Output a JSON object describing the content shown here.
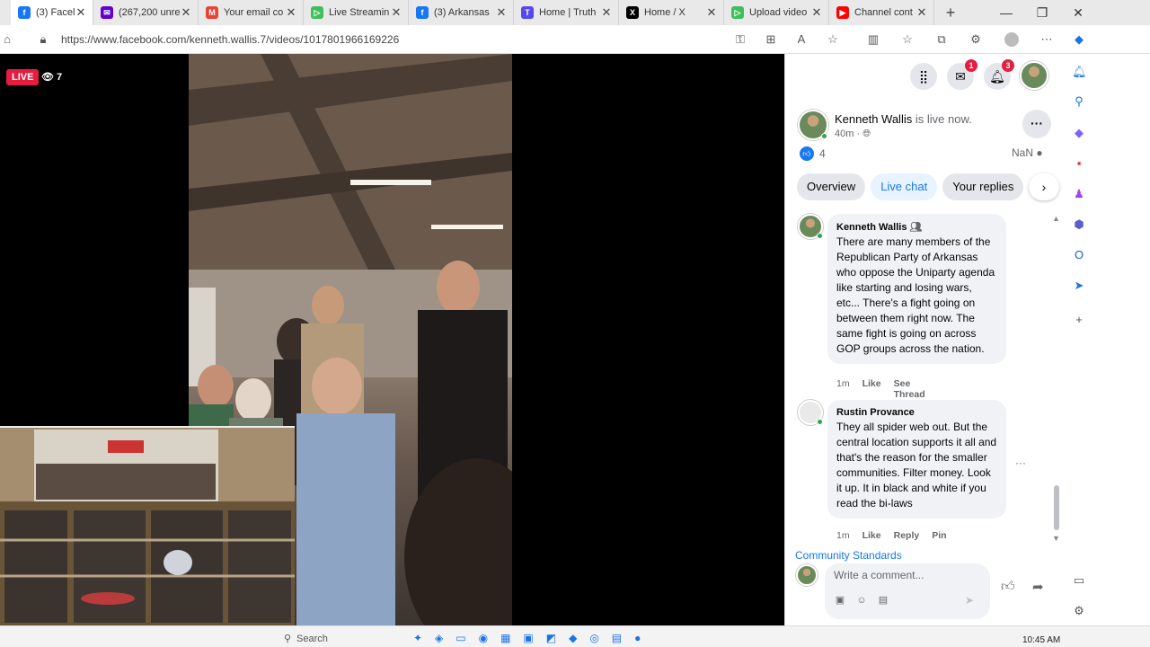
{
  "browser": {
    "tabs": [
      {
        "title": "(3) Facel",
        "color": "#1877f2",
        "glyph": "f"
      },
      {
        "title": "(267,200 unre",
        "color": "#6001d2",
        "glyph": "✉"
      },
      {
        "title": "Your email co",
        "color": "#ea4335",
        "glyph": "M"
      },
      {
        "title": "Live Streamin",
        "color": "#3fbf5a",
        "glyph": "▷"
      },
      {
        "title": "(3) Arkansas",
        "color": "#1877f2",
        "glyph": "f"
      },
      {
        "title": "Home | Truth",
        "color": "#5448ee",
        "glyph": "T"
      },
      {
        "title": "Home / X",
        "color": "#000000",
        "glyph": "X"
      },
      {
        "title": "Upload video",
        "color": "#3fbf5a",
        "glyph": "▷"
      },
      {
        "title": "Channel cont",
        "color": "#ff0000",
        "glyph": "▶"
      }
    ],
    "url": "https://www.facebook.com/kenneth.wallis.7/videos/1017801966169226"
  },
  "video": {
    "live_label": "LIVE",
    "viewer_count": "7"
  },
  "panel": {
    "header_badges": {
      "messenger": "1",
      "notifications": "3"
    },
    "host": {
      "name": "Kenneth Wallis",
      "status": "is live now.",
      "time": "40m ·"
    },
    "like_count": "4",
    "nan_label": "NaN",
    "tabs": [
      "Overview",
      "Live chat",
      "Your replies"
    ],
    "selected_tab": "Live chat",
    "comments": [
      {
        "name": "Kenneth Wallis",
        "text": "There are many members of the Republican Party of Arkansas who oppose the Uniparty agenda like starting and losing wars, etc... There's a fight going on between them right now. The same fight is going on across GOP groups across the nation.",
        "time": "1m",
        "actions": [
          "Like",
          "See Thread"
        ]
      },
      {
        "name": "Rustin Provance",
        "text": "They all spider web out. But the central location supports it all and that's the reason for the smaller communities. Filter money. Look it up. It in black and white if you read the bi-laws",
        "time": "1m",
        "actions": [
          "Like",
          "Reply",
          "Pin"
        ]
      }
    ],
    "community_standards": "Community Standards",
    "write_placeholder": "Write a comment..."
  },
  "taskbar": {
    "search_label": "Search",
    "clock": "10:45 AM"
  }
}
